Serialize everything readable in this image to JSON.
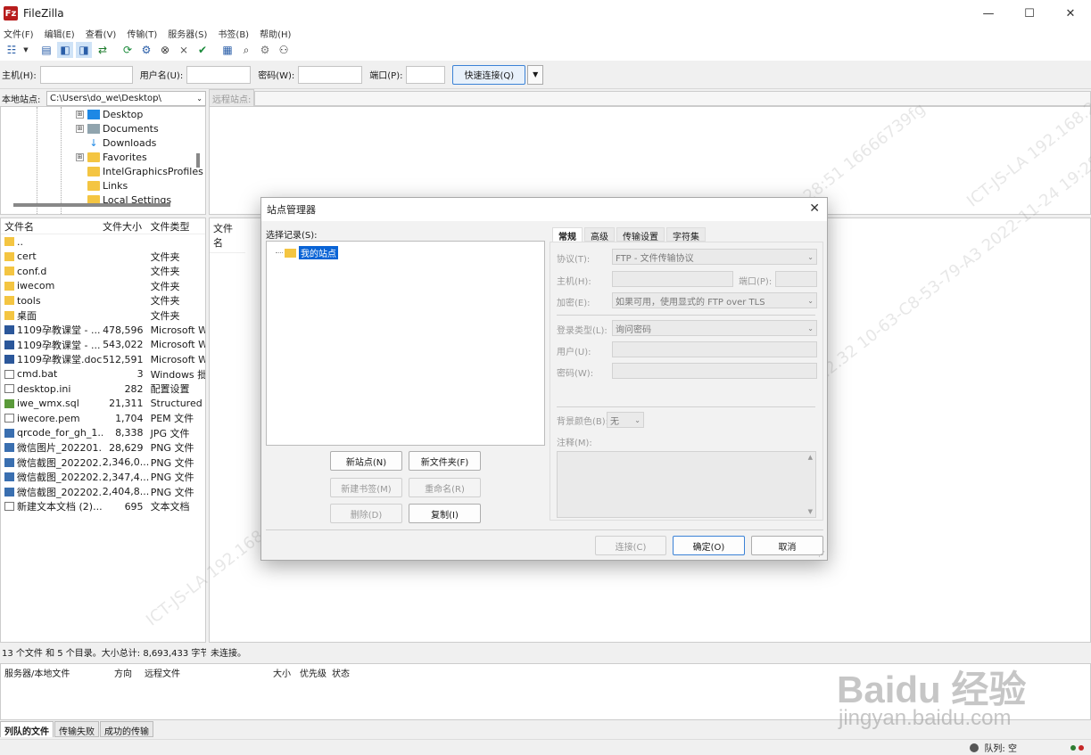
{
  "window": {
    "title": "FileZilla",
    "icon": "Fz",
    "minimize": "—",
    "maximize": "☐",
    "close": "✕"
  },
  "menu": [
    "文件(F)",
    "编辑(E)",
    "查看(V)",
    "传输(T)",
    "服务器(S)",
    "书签(B)",
    "帮助(H)"
  ],
  "quickconnect": {
    "host_label": "主机(H):",
    "user_label": "用户名(U):",
    "pass_label": "密码(W):",
    "port_label": "端口(P):",
    "button": "快速连接(Q)",
    "dropdown": "▼"
  },
  "local": {
    "label": "本地站点:",
    "path": "C:\\Users\\do_we\\Desktop\\",
    "tree": [
      {
        "label": "Desktop",
        "expander": "⊞",
        "icon": "desktop"
      },
      {
        "label": "Documents",
        "expander": "⊞",
        "icon": "documents"
      },
      {
        "label": "Downloads",
        "expander": "",
        "icon": "downloads"
      },
      {
        "label": "Favorites",
        "expander": "⊞",
        "icon": "folder"
      },
      {
        "label": "IntelGraphicsProfiles",
        "expander": "",
        "icon": "folder"
      },
      {
        "label": "Links",
        "expander": "",
        "icon": "folder"
      },
      {
        "label": "Local Settings",
        "expander": "",
        "icon": "folder"
      }
    ],
    "columns": {
      "name": "文件名",
      "size": "文件大小",
      "type": "文件类型"
    },
    "files": [
      {
        "name": "..",
        "size": "",
        "type": "",
        "icon": "folder"
      },
      {
        "name": "cert",
        "size": "",
        "type": "文件夹",
        "icon": "folder"
      },
      {
        "name": "conf.d",
        "size": "",
        "type": "文件夹",
        "icon": "folder"
      },
      {
        "name": "iwecom",
        "size": "",
        "type": "文件夹",
        "icon": "folder"
      },
      {
        "name": "tools",
        "size": "",
        "type": "文件夹",
        "icon": "folder"
      },
      {
        "name": "桌面",
        "size": "",
        "type": "文件夹",
        "icon": "folder"
      },
      {
        "name": "1109孕教课堂 - ...",
        "size": "478,596",
        "type": "Microsoft W",
        "icon": "word"
      },
      {
        "name": "1109孕教课堂 - ...",
        "size": "543,022",
        "type": "Microsoft W",
        "icon": "word"
      },
      {
        "name": "1109孕教课堂.docx",
        "size": "512,591",
        "type": "Microsoft W",
        "icon": "word"
      },
      {
        "name": "cmd.bat",
        "size": "3",
        "type": "Windows 批",
        "icon": "doc"
      },
      {
        "name": "desktop.ini",
        "size": "282",
        "type": "配置设置",
        "icon": "doc"
      },
      {
        "name": "iwe_wmx.sql",
        "size": "21,311",
        "type": "Structured ...",
        "icon": "sql"
      },
      {
        "name": "iwecore.pem",
        "size": "1,704",
        "type": "PEM 文件",
        "icon": "doc"
      },
      {
        "name": "qrcode_for_gh_1...",
        "size": "8,338",
        "type": "JPG 文件",
        "icon": "img"
      },
      {
        "name": "微信图片_202201...",
        "size": "28,629",
        "type": "PNG 文件",
        "icon": "img"
      },
      {
        "name": "微信截图_202202...",
        "size": "2,346,0...",
        "type": "PNG 文件",
        "icon": "img"
      },
      {
        "name": "微信截图_202202...",
        "size": "2,347,4...",
        "type": "PNG 文件",
        "icon": "img"
      },
      {
        "name": "微信截图_202202...",
        "size": "2,404,8...",
        "type": "PNG 文件",
        "icon": "img"
      },
      {
        "name": "新建文本文档 (2)....",
        "size": "695",
        "type": "文本文档",
        "icon": "doc"
      }
    ],
    "status": "13 个文件 和 5 个目录。大小总计: 8,693,433 字节"
  },
  "remote": {
    "label": "远程站点:",
    "columns": {
      "name": "文件名"
    },
    "status": "未连接。"
  },
  "queue": {
    "columns": [
      "服务器/本地文件",
      "方向",
      "远程文件",
      "大小",
      "优先级",
      "状态"
    ],
    "tabs": [
      "列队的文件",
      "传输失败",
      "成功的传输"
    ],
    "queue_status": "队列: 空"
  },
  "dialog": {
    "title": "站点管理器",
    "close": "✕",
    "select_label": "选择记录(S):",
    "root_node": "我的站点",
    "buttons": {
      "new_site": "新站点(N)",
      "new_folder": "新文件夹(F)",
      "new_bookmark": "新建书签(M)",
      "rename": "重命名(R)",
      "delete": "删除(D)",
      "copy": "复制(I)",
      "connect": "连接(C)",
      "ok": "确定(O)",
      "cancel": "取消"
    },
    "tabs": [
      "常规",
      "高级",
      "传输设置",
      "字符集"
    ],
    "form": {
      "protocol_label": "协议(T):",
      "protocol_value": "FTP - 文件传输协议",
      "host_label": "主机(H):",
      "port_label": "端口(P):",
      "encryption_label": "加密(E):",
      "encryption_value": "如果可用，使用显式的 FTP over TLS",
      "logon_label": "登录类型(L):",
      "logon_value": "询问密码",
      "user_label": "用户(U):",
      "password_label": "密码(W):",
      "bgcolor_label": "背景颜色(B):",
      "bgcolor_value": "无",
      "comment_label": "注释(M):"
    }
  },
  "watermark": {
    "text": "ICT-JS-LA  192.168.2.32  10-63-C8-53-79-A3  2022-11-24 19:28:51  16666739fg",
    "baidu_logo": "Baidu 经验",
    "baidu_url": "jingyan.baidu.com"
  },
  "colors": {
    "accent": "#0a64d6",
    "folder": "#f4c542",
    "app_icon": "#b71c1c"
  }
}
